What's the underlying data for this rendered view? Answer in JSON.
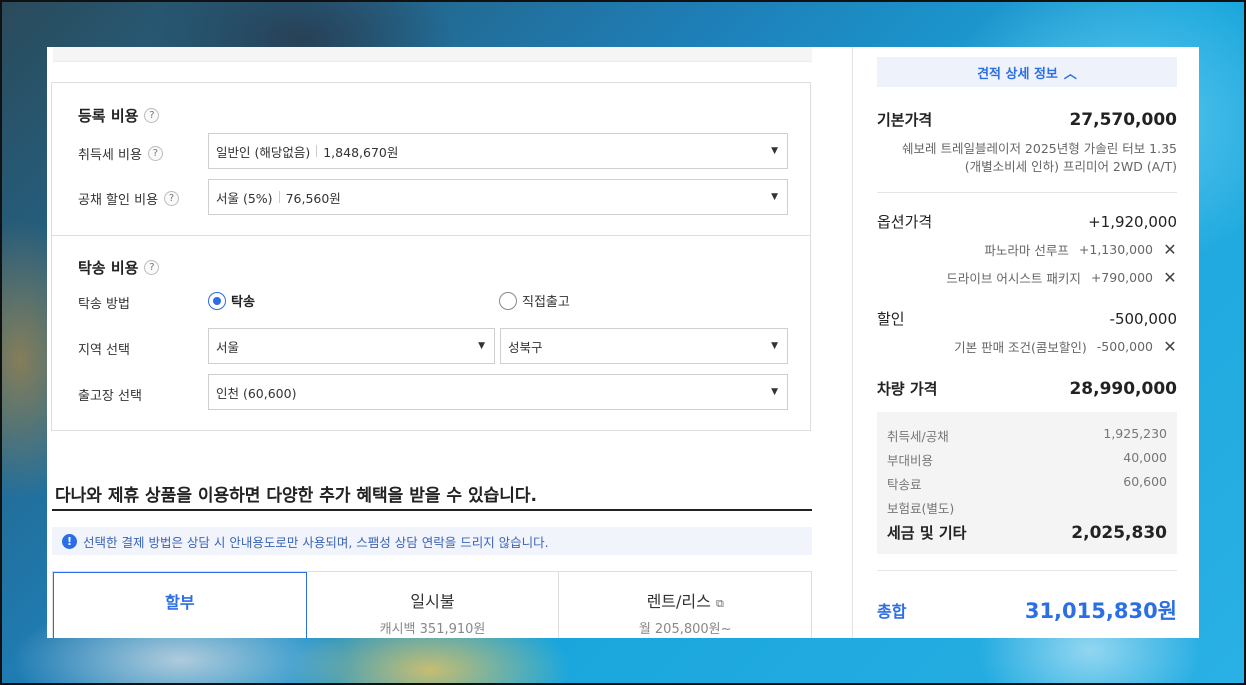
{
  "registration": {
    "title": "등록 비용",
    "acquisition_label": "취득세 비용",
    "acquisition_value": "일반인 (해당없음)",
    "acquisition_amount": "1,848,670원",
    "bond_label": "공채 할인 비용",
    "bond_value": "서울 (5%)",
    "bond_amount": "76,560원"
  },
  "shipping": {
    "title": "탁송 비용",
    "method_label": "탁송 방법",
    "method_options": [
      "탁송",
      "직접출고"
    ],
    "method_selected": "탁송",
    "region_label": "지역 선택",
    "region_city": "서울",
    "region_district": "성북구",
    "depot_label": "출고장 선택",
    "depot_value": "인천 (60,600)"
  },
  "promo": {
    "title": "다나와 제휴 상품을 이용하면 다양한 추가 혜택을 받을 수 있습니다.",
    "notice": "선택한 결제 방법은 상담 시 안내용도로만 사용되며, 스팸성 상담 연락을 드리지 않습니다.",
    "tabs": [
      {
        "title": "할부",
        "sub": ""
      },
      {
        "title": "일시불",
        "sub": "캐시백 351,910원"
      },
      {
        "title": "렌트/리스",
        "sub": "월 205,800원~"
      }
    ]
  },
  "summary": {
    "detail_button": "견적 상세 정보",
    "base_label": "기본가격",
    "base_value": "27,570,000",
    "model_line1": "쉐보레 트레일블레이저 2025년형 가솔린 터보 1.35",
    "model_line2": "(개별소비세 인하) 프리미어 2WD (A/T)",
    "option_label": "옵션가격",
    "option_value": "+1,920,000",
    "options": [
      {
        "name": "파노라마 선루프",
        "price": "+1,130,000"
      },
      {
        "name": "드라이브 어시스트 패키지",
        "price": "+790,000"
      }
    ],
    "discount_label": "할인",
    "discount_value": "-500,000",
    "discounts": [
      {
        "name": "기본 판매 조건(콤보할인)",
        "price": "-500,000"
      }
    ],
    "vehicle_label": "차량 가격",
    "vehicle_value": "28,990,000",
    "taxes": [
      {
        "name": "취득세/공채",
        "value": "1,925,230"
      },
      {
        "name": "부대비용",
        "value": "40,000"
      },
      {
        "name": "탁송료",
        "value": "60,600"
      },
      {
        "name": "보험료(별도)",
        "value": ""
      }
    ],
    "tax_total_label": "세금 및 기타",
    "tax_total_value": "2,025,830",
    "total_label": "총합",
    "total_value": "31,015,830원"
  },
  "icons": {
    "help": "?",
    "dropdown": "▼",
    "remove": "✕",
    "info": "!",
    "chevron_up": "︿",
    "external": "⧉"
  }
}
